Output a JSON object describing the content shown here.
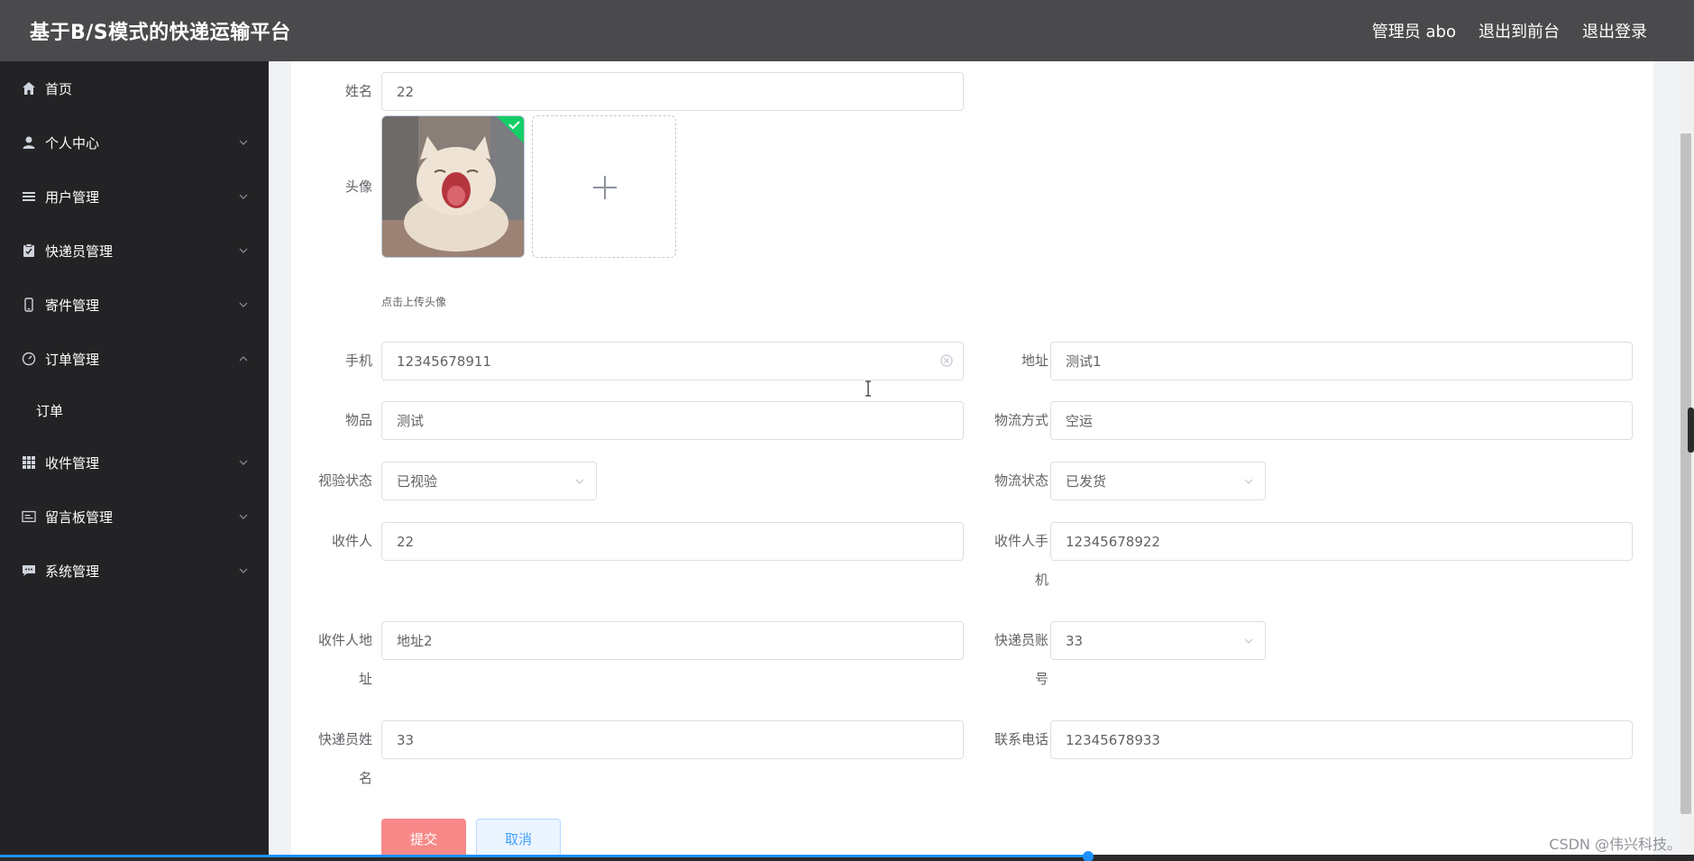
{
  "header": {
    "title": "基于B/S模式的快递运输平台",
    "admin": "管理员 abo",
    "to_front": "退出到前台",
    "logout": "退出登录"
  },
  "sidebar": {
    "items": [
      {
        "label": "首页",
        "icon": "home-icon"
      },
      {
        "label": "个人中心",
        "icon": "user-icon"
      },
      {
        "label": "用户管理",
        "icon": "list-icon"
      },
      {
        "label": "快递员管理",
        "icon": "clipboard-icon"
      },
      {
        "label": "寄件管理",
        "icon": "phone-icon"
      },
      {
        "label": "订单管理",
        "icon": "gauge-icon",
        "expanded": true
      },
      {
        "label": "订单",
        "sub": true
      },
      {
        "label": "收件管理",
        "icon": "grid-icon"
      },
      {
        "label": "留言板管理",
        "icon": "message-icon"
      },
      {
        "label": "系统管理",
        "icon": "chat-icon"
      }
    ]
  },
  "form": {
    "name_label": "姓名",
    "name_value": "22",
    "avatar_label": "头像",
    "avatar_tip": "点击上传头像",
    "phone_label": "手机",
    "phone_value": "12345678911",
    "address_label": "地址",
    "address_value": "测试1",
    "item_label": "物品",
    "item_value": "测试",
    "logistics_method_label": "物流方式",
    "logistics_method_value": "空运",
    "inspect_label": "视验状态",
    "inspect_value": "已视验",
    "logistics_status_label": "物流状态",
    "logistics_status_value": "已发货",
    "receiver_label": "收件人",
    "receiver_value": "22",
    "receiver_phone_label_1": "收件人手",
    "receiver_phone_label_2": "机",
    "receiver_phone_value": "12345678922",
    "receiver_addr_label_1": "收件人地",
    "receiver_addr_label_2": "址",
    "receiver_addr_value": "地址2",
    "courier_account_label_1": "快递员账",
    "courier_account_label_2": "号",
    "courier_account_value": "33",
    "courier_name_label_1": "快递员姓",
    "courier_name_label_2": "名",
    "courier_name_value": "33",
    "contact_label": "联系电话",
    "contact_value": "12345678933",
    "submit": "提交",
    "cancel": "取消"
  },
  "watermark": "CSDN @伟兴科技。",
  "colors": {
    "header_bg": "#4a4a4d",
    "sidebar_bg": "#232325",
    "submit_bg": "#f78989",
    "cancel_bg": "#ecf5ff",
    "success": "#13ce66"
  }
}
